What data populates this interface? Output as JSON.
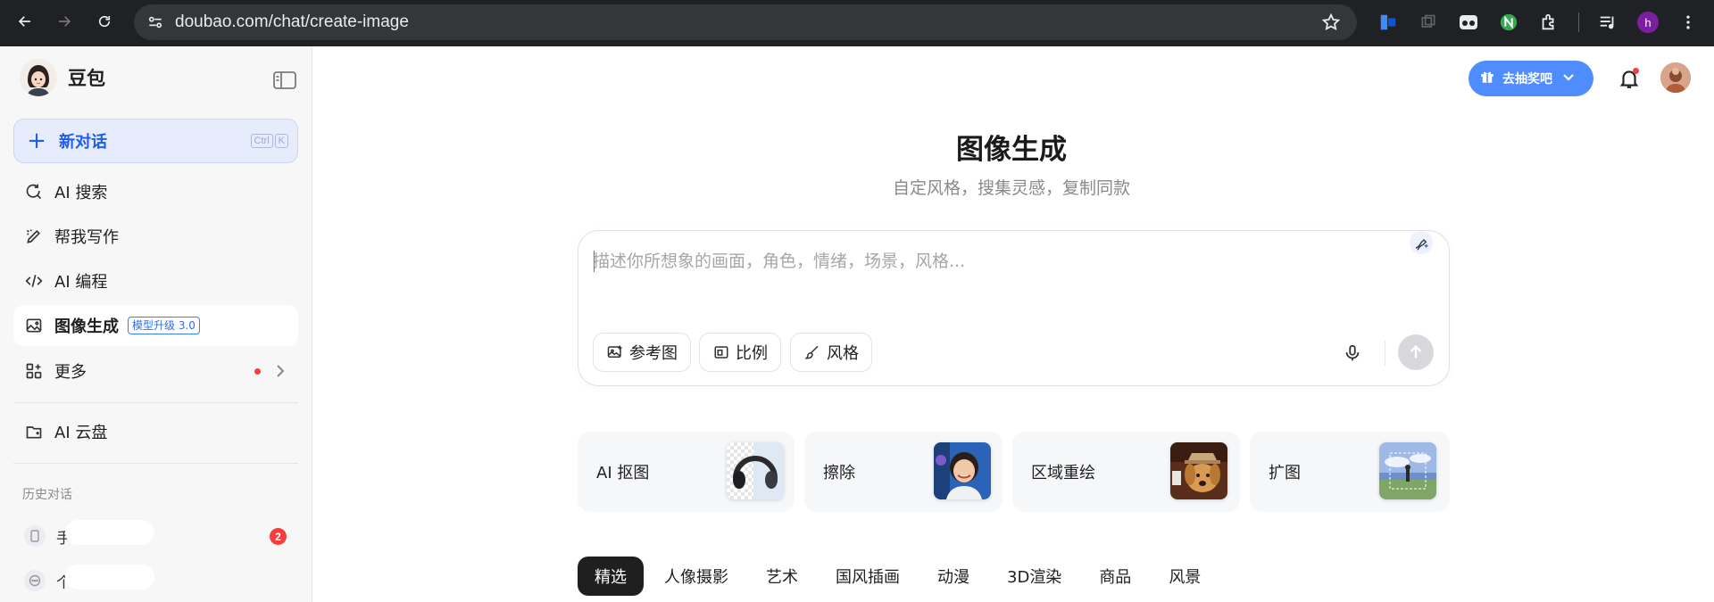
{
  "browser": {
    "url": "doubao.com/chat/create-image",
    "profile_initial": "h"
  },
  "sidebar": {
    "brand": "豆包",
    "new_chat": {
      "label": "新对话",
      "shortcut": [
        "Ctrl",
        "K"
      ]
    },
    "items": [
      {
        "label": "AI 搜索",
        "icon": "search-refresh-icon"
      },
      {
        "label": "帮我写作",
        "icon": "pen-write-icon"
      },
      {
        "label": "AI 编程",
        "icon": "code-icon"
      },
      {
        "label": "图像生成",
        "icon": "image-icon",
        "badge": "模型升级 3.0",
        "active": true
      },
      {
        "label": "更多",
        "icon": "grid-icon",
        "has_dot": true
      }
    ],
    "cloud": {
      "label": "AI 云盘",
      "icon": "folder-cloud-icon"
    },
    "history_title": "历史对话",
    "history": [
      {
        "label": "手",
        "badge": "2",
        "icon": "phone-icon"
      },
      {
        "label": "个",
        "icon": "chat-bubble-icon"
      }
    ]
  },
  "header": {
    "lottery_label": "去抽奖吧"
  },
  "main": {
    "title": "图像生成",
    "subtitle": "自定风格，搜集灵感，复制同款",
    "prompt": {
      "placeholder": "描述你所想象的画面，角色，情绪，场景，风格...",
      "value": "",
      "chips": [
        {
          "label": "参考图",
          "icon": "reference-image-icon"
        },
        {
          "label": "比例",
          "icon": "aspect-ratio-icon"
        },
        {
          "label": "风格",
          "icon": "brush-icon"
        }
      ]
    },
    "tools": [
      {
        "label": "AI 抠图",
        "icon": "headphones-thumbnail"
      },
      {
        "label": "擦除",
        "icon": "girl-thumbnail"
      },
      {
        "label": "区域重绘",
        "icon": "dog-thumbnail"
      },
      {
        "label": "扩图",
        "icon": "landscape-thumbnail"
      }
    ],
    "tabs": [
      "精选",
      "人像摄影",
      "艺术",
      "国风插画",
      "动漫",
      "3D渲染",
      "商品",
      "风景"
    ],
    "active_tab": "精选"
  },
  "colors": {
    "accent": "#1f5cf0",
    "lottery_bg": "#4f8cff",
    "active_tab_bg": "#1f1f1f",
    "red_badge": "#f53f3f"
  }
}
